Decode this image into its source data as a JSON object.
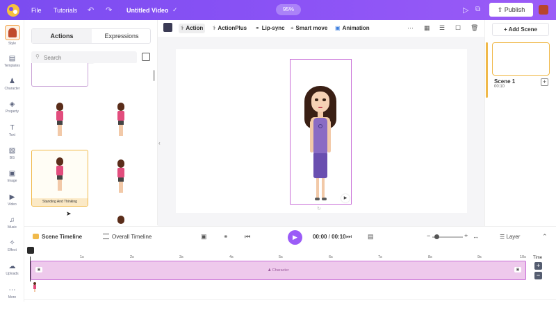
{
  "topbar": {
    "menu": [
      "File",
      "Tutorials"
    ],
    "title": "Untitled Video",
    "zoom": "95%",
    "publish_label": "Publish"
  },
  "rail": {
    "items": [
      {
        "label": "Style",
        "icon": "style-icon"
      },
      {
        "label": "Templates",
        "icon": "templates-icon"
      },
      {
        "label": "Character",
        "icon": "character-icon"
      },
      {
        "label": "Property",
        "icon": "property-icon"
      },
      {
        "label": "Text",
        "icon": "text-icon"
      },
      {
        "label": "BG",
        "icon": "bg-icon"
      },
      {
        "label": "Image",
        "icon": "image-icon"
      },
      {
        "label": "Video",
        "icon": "video-icon"
      },
      {
        "label": "Music",
        "icon": "music-icon"
      },
      {
        "label": "Effect",
        "icon": "effect-icon"
      },
      {
        "label": "Uploads",
        "icon": "uploads-icon"
      },
      {
        "label": "More",
        "icon": "more-icon"
      }
    ]
  },
  "panel": {
    "tabs": [
      "Actions",
      "Expressions"
    ],
    "active_tab": "Actions",
    "search_placeholder": "Search",
    "selected_card_caption": "Standing And Thinking"
  },
  "canvas_toolbar": {
    "buttons": [
      "Action",
      "ActionPlus",
      "Lip-sync",
      "Smart move",
      "Animation"
    ],
    "active": "Action"
  },
  "scenes": {
    "add_label": "+ Add Scene",
    "items": [
      {
        "name": "Scene 1",
        "duration": "00:10"
      }
    ]
  },
  "timeline": {
    "tabs": [
      "Scene Timeline",
      "Overall Timeline"
    ],
    "active_tab": "Scene Timeline",
    "current_time": "00:00",
    "total_time": "00:10",
    "layer_label": "Layer",
    "ticks": [
      "1s",
      "2s",
      "3s",
      "4s",
      "5s",
      "6s",
      "7s",
      "8s",
      "9s",
      "10s"
    ],
    "track_label": "Character",
    "time_label": "Time"
  },
  "colors": {
    "brand": "#8a52f5",
    "selection": "#c86dd7",
    "track_fill": "#eec9ec",
    "highlight": "#f0b94a"
  }
}
